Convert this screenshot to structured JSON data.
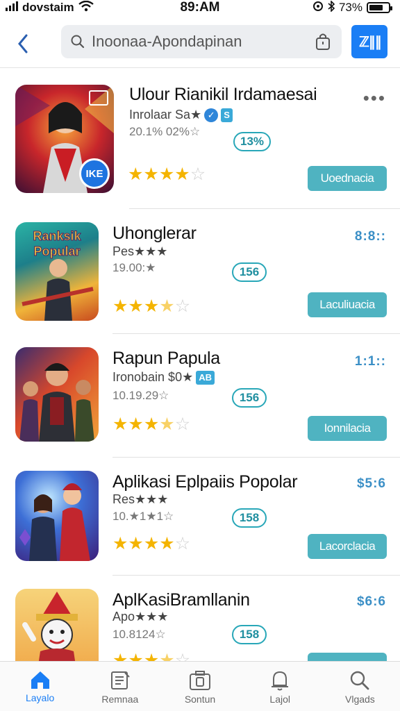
{
  "status_bar": {
    "carrier": "dovstaim",
    "time": "89:AM",
    "battery": "73%",
    "battery_level": 0.73
  },
  "header": {
    "search_placeholder": "Inoonaa-Apondapinan",
    "action_label": "ℤ∥∥",
    "accent_color": "#1a7ef5"
  },
  "apps": [
    {
      "title": "Ulour Rianikil Irdamaesai",
      "subtitle": "Inrolaar Sa★",
      "meta": "20.1% 02%☆",
      "rating": 4,
      "size_badge": "13%",
      "cta_label": "Uoednacia",
      "top_right": "•••",
      "thumb_text": "IKE"
    },
    {
      "title": "Uhonglerar",
      "subtitle": "Pes★★★",
      "meta": "19.00:★",
      "rating": 3.5,
      "size_badge": "156",
      "cta_label": "Laculiuacia",
      "top_right": "8:8::",
      "thumb_text": "Ranksik Popular"
    },
    {
      "title": "Rapun Papula",
      "subtitle": "Ironobain $0★",
      "meta": "10.19.29☆",
      "rating": 3.5,
      "size_badge": "156",
      "cta_label": "Ionnilacia",
      "top_right": "1:1::",
      "thumb_text": ""
    },
    {
      "title": "Aplikasi Eplpaiis Popolar",
      "subtitle": "Res★★★",
      "meta": "10.★1★1☆",
      "rating": 4,
      "size_badge": "158",
      "cta_label": "Lacorclacia",
      "top_right": "$5:6",
      "thumb_text": ""
    },
    {
      "title": "AplKasiBramllanin",
      "subtitle": "Apo★★★",
      "meta": "10.8124☆",
      "rating": 3.5,
      "size_badge": "158",
      "cta_label": "",
      "top_right": "$6:6",
      "thumb_text": ""
    }
  ],
  "tabs": [
    {
      "label": "Layalo",
      "icon": "home-icon",
      "active": true
    },
    {
      "label": "Remnaa",
      "icon": "note-icon",
      "active": false
    },
    {
      "label": "Sontun",
      "icon": "camera-icon",
      "active": false
    },
    {
      "label": "Lajol",
      "icon": "bell-icon",
      "active": false
    },
    {
      "label": "Vlgads",
      "icon": "search-icon",
      "active": false
    }
  ]
}
